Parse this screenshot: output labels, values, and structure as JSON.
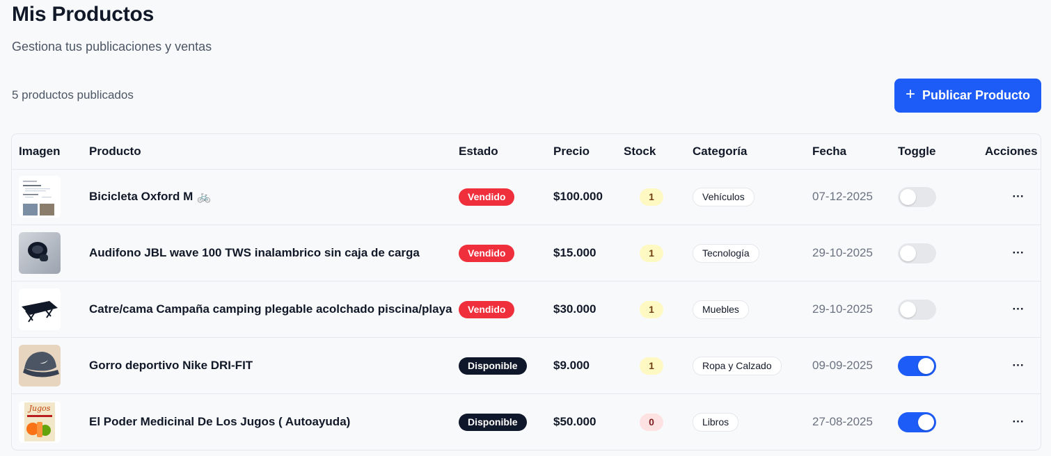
{
  "header": {
    "title": "Mis Productos",
    "subtitle": "Gestiona tus publicaciones y ventas",
    "count_text": "5 productos publicados",
    "publish_plus": "+",
    "publish_label": "Publicar Producto"
  },
  "table": {
    "columns": [
      "Imagen",
      "Producto",
      "Estado",
      "Precio",
      "Stock",
      "Categoría",
      "Fecha",
      "Toggle",
      "Acciones"
    ],
    "rows": [
      {
        "name": "Bicicleta Oxford M",
        "glyph": "🚲",
        "status": "Vendido",
        "status_type": "sold",
        "price": "$100.000",
        "stock": "1",
        "category": "Vehículos",
        "date": "07-12-2025",
        "toggle_on": false,
        "actions": "···",
        "thumb_icon": "document-photo-icon"
      },
      {
        "name": "Audifono JBL wave 100 TWS inalambrico sin caja de carga",
        "glyph": "",
        "status": "Vendido",
        "status_type": "sold",
        "price": "$15.000",
        "stock": "1",
        "category": "Tecnología",
        "date": "29-10-2025",
        "toggle_on": false,
        "actions": "···",
        "thumb_icon": "earbuds-photo-icon"
      },
      {
        "name": "Catre/cama Campaña camping plegable acolchado piscina/playa",
        "glyph": "",
        "status": "Vendido",
        "status_type": "sold",
        "price": "$30.000",
        "stock": "1",
        "category": "Muebles",
        "date": "29-10-2025",
        "toggle_on": false,
        "actions": "···",
        "thumb_icon": "camping-cot-photo-icon"
      },
      {
        "name": "Gorro deportivo Nike DRI-FIT",
        "glyph": "",
        "status": "Disponible",
        "status_type": "available",
        "price": "$9.000",
        "stock": "1",
        "category": "Ropa y Calzado",
        "date": "09-09-2025",
        "toggle_on": true,
        "actions": "···",
        "thumb_icon": "cap-photo-icon"
      },
      {
        "name": "El Poder Medicinal De Los Jugos ( Autoayuda)",
        "glyph": "",
        "status": "Disponible",
        "status_type": "available",
        "price": "$50.000",
        "stock": "0",
        "category": "Libros",
        "date": "27-08-2025",
        "toggle_on": true,
        "actions": "···",
        "thumb_icon": "book-cover-photo-icon",
        "book_cover_text": "Jugos"
      }
    ]
  },
  "colors": {
    "primary": "#1d5cf6",
    "sold_badge": "#ef2f3c",
    "available_badge": "#0f172a",
    "stock_ok_bg": "#fef9c3",
    "stock_zero_bg": "#fee2e2"
  }
}
